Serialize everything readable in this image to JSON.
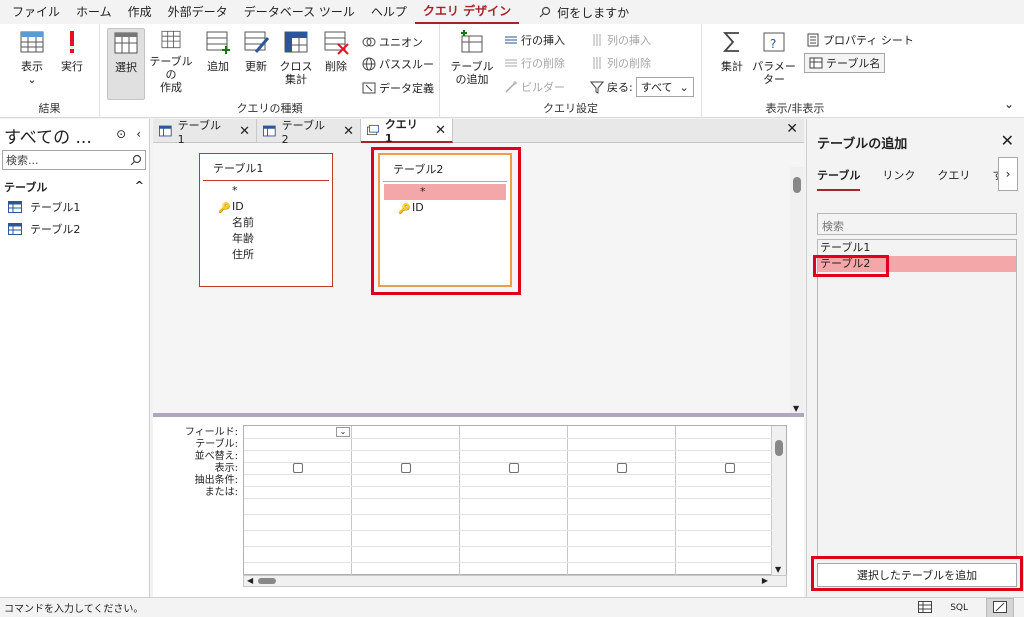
{
  "menu": {
    "items": [
      "ファイル",
      "ホーム",
      "作成",
      "外部データ",
      "データベース ツール",
      "ヘルプ"
    ],
    "active_tab": "クエリ デザイン",
    "tell_me": "何をしますか"
  },
  "ribbon": {
    "results": {
      "label": "結果",
      "view": "表示",
      "run": "実行"
    },
    "query_type": {
      "label": "クエリの種類",
      "select": "選択",
      "make_table_1": "テーブルの",
      "make_table_2": "作成",
      "append": "追加",
      "update": "更新",
      "crosstab_1": "クロス",
      "crosstab_2": "集計",
      "delete": "削除",
      "union": "ユニオン",
      "passthrough": "パススルー",
      "data_definition": "データ定義"
    },
    "query_setup": {
      "label": "クエリ設定",
      "add_table_1": "テーブル",
      "add_table_2": "の追加",
      "insert_rows": "行の挿入",
      "delete_rows": "行の削除",
      "builder": "ビルダー",
      "insert_columns": "列の挿入",
      "delete_columns": "列の削除",
      "return_label": "戻る:",
      "return_value": "すべて"
    },
    "show_hide": {
      "label": "表示/非表示",
      "totals": "集計",
      "parameters": "パラメーター",
      "property_sheet": "プロパティ シート",
      "table_names": "テーブル名"
    }
  },
  "nav": {
    "title": "すべての ...",
    "search_placeholder": "検索...",
    "section": "テーブル",
    "objects": [
      "テーブル1",
      "テーブル2"
    ]
  },
  "doc_tabs": [
    "テーブル1",
    "テーブル2",
    "クエリ1"
  ],
  "tables": [
    {
      "name": "テーブル1",
      "fields": [
        "*",
        "ID",
        "名前",
        "年齢",
        "住所"
      ]
    },
    {
      "name": "テーブル2",
      "fields": [
        "*",
        "ID"
      ]
    }
  ],
  "grid_labels": [
    "フィールド:",
    "テーブル:",
    "並べ替え:",
    "表示:",
    "抽出条件:",
    "または:"
  ],
  "add_pane": {
    "title": "テーブルの追加",
    "tabs": [
      "テーブル",
      "リンク",
      "クエリ",
      "すべ"
    ],
    "search_placeholder": "検索",
    "list": [
      "テーブル1",
      "テーブル2"
    ],
    "add_button": "選択したテーブルを追加"
  },
  "status": {
    "text": "コマンドを入力してください。",
    "sql": "SQL"
  }
}
